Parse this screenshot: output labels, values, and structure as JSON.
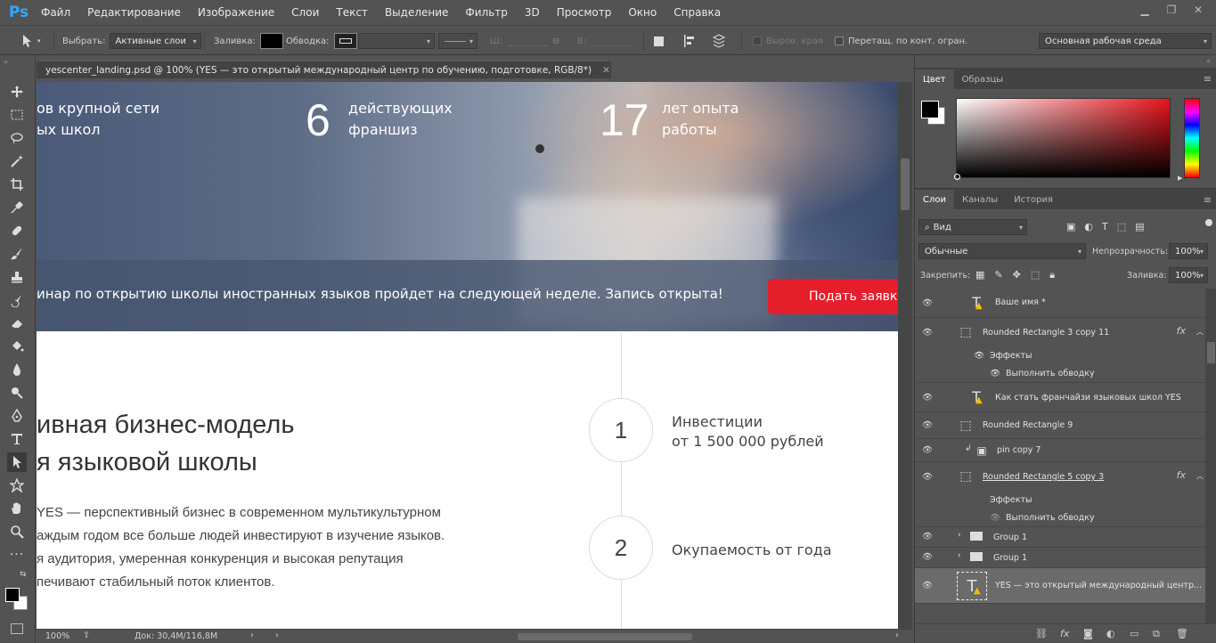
{
  "app": {
    "logo": "Ps"
  },
  "menu": [
    "Файл",
    "Редактирование",
    "Изображение",
    "Слои",
    "Текст",
    "Выделение",
    "Фильтр",
    "3D",
    "Просмотр",
    "Окно",
    "Справка"
  ],
  "options": {
    "select_label": "Выбрать:",
    "select_value": "Активные слои",
    "fill_label": "Заливка:",
    "stroke_label": "Обводка:",
    "w_label": "Ш:",
    "h_label": "В:",
    "align_edges": "Выров. края",
    "drag_bounds": "Перетащ. по конт. огран.",
    "workspace": "Основная рабочая среда"
  },
  "document": {
    "tab_title": "yescenter_landing.psd @ 100% (YES — это открытый международный центр  по обучению, подготовке, RGB/8*)",
    "stats": [
      {
        "num": "",
        "line1": "ов крупной сети",
        "line2": "ых школ"
      },
      {
        "num": "6",
        "line1": "действующих",
        "line2": "франшиз"
      },
      {
        "num": "17",
        "line1": "лет опыта",
        "line2": "работы"
      }
    ],
    "promo_text": "инар по открытию школы иностранных языков пройдет на следующей неделе. Запись открыта!",
    "promo_button": "Подать заявку",
    "heading_line1": "ивная бизнес-модель",
    "heading_line2": "я языковой школы",
    "body_lines": [
      "YES — перспективный бизнес в современном мультикультурном",
      "аждым годом все больше людей инвестируют в изучение языков.",
      "я аудитория, умеренная конкуренция и высокая репутация",
      "печивают стабильный поток клиентов."
    ],
    "steps": [
      {
        "num": "1",
        "line1": "Инвестиции",
        "line2": "от 1 500 000 рублей"
      },
      {
        "num": "2",
        "line1": "Окупаемость от года",
        "line2": ""
      }
    ]
  },
  "status": {
    "zoom": "100%",
    "doc_size": "Док: 30,4M/116,8M"
  },
  "color_panel": {
    "tabs": [
      "Цвет",
      "Образцы"
    ]
  },
  "layers_panel": {
    "tabs": [
      "Слои",
      "Каналы",
      "История"
    ],
    "filter": "Вид",
    "blend_mode": "Обычные",
    "opacity_label": "Непрозрачность:",
    "opacity_value": "100%",
    "lock_label": "Закрепить:",
    "fill_label": "Заливка:",
    "fill_value": "100%",
    "layers": [
      {
        "name": "Ваше имя *",
        "kind": "text-warning"
      },
      {
        "name": "Rounded Rectangle 3 copy 11",
        "kind": "shape",
        "fx": "fx"
      },
      {
        "name": "Эффекты",
        "kind": "effects"
      },
      {
        "name": "Выполнить обводку",
        "kind": "effect"
      },
      {
        "name": "Как стать франчайзи языковых школ YES",
        "kind": "text-warning"
      },
      {
        "name": "Rounded Rectangle 9",
        "kind": "shape"
      },
      {
        "name": "pin copy 7",
        "kind": "smart"
      },
      {
        "name": "Rounded Rectangle 5 copy 3",
        "kind": "shape",
        "fx": "fx"
      },
      {
        "name": "Эффекты",
        "kind": "effects"
      },
      {
        "name": "Выполнить обводку",
        "kind": "effect"
      },
      {
        "name": "Group 1",
        "kind": "group"
      },
      {
        "name": "Group 1",
        "kind": "group"
      },
      {
        "name": "YES — это открытый международный центр...",
        "kind": "text-warning"
      }
    ]
  }
}
